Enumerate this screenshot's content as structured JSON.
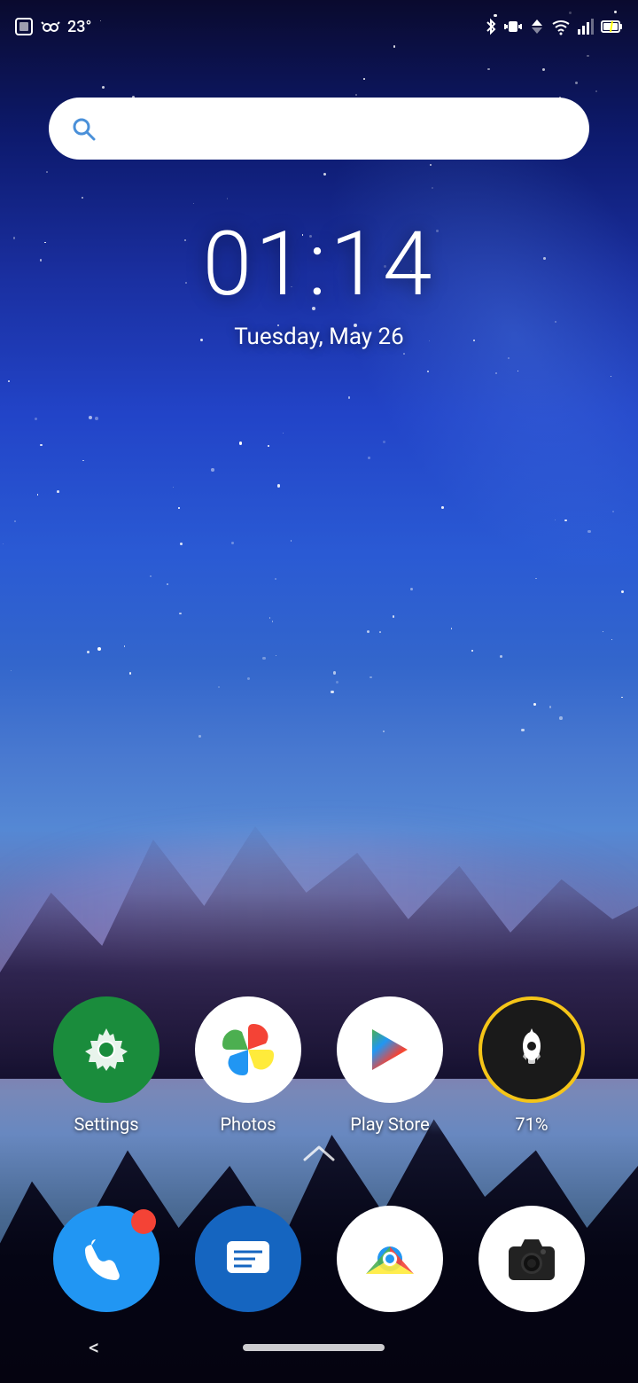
{
  "statusBar": {
    "temperature": "23°",
    "time": "01:14",
    "date": "Tuesday, May 26"
  },
  "searchBar": {
    "placeholder": ""
  },
  "clock": {
    "time": "01:14",
    "date": "Tuesday, May 26"
  },
  "apps": [
    {
      "id": "settings",
      "label": "Settings"
    },
    {
      "id": "photos",
      "label": "Photos"
    },
    {
      "id": "playstore",
      "label": "Play Store"
    },
    {
      "id": "rocket",
      "label": "71%"
    }
  ],
  "dock": [
    {
      "id": "phone",
      "label": "Phone",
      "badge": true
    },
    {
      "id": "messages",
      "label": "Messages",
      "badge": false
    },
    {
      "id": "chrome",
      "label": "Chrome",
      "badge": false
    },
    {
      "id": "camera",
      "label": "Camera",
      "badge": false
    }
  ],
  "navbar": {
    "back": "<",
    "home": ""
  }
}
